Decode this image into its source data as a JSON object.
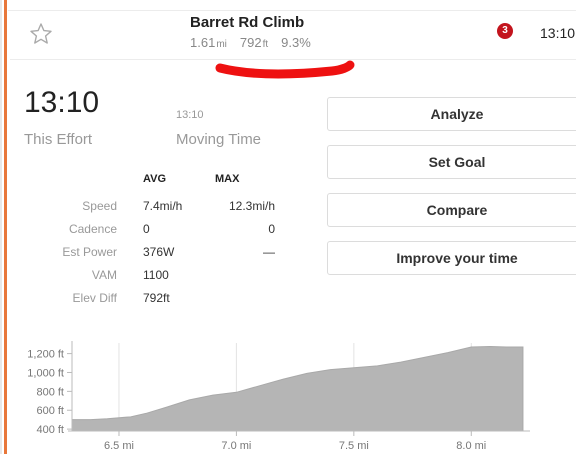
{
  "segment": {
    "title": "Barret Rd Climb",
    "distance_value": "1.61",
    "distance_unit": "mi",
    "elevation_value": "792",
    "elevation_unit": "ft",
    "grade": "9.3%",
    "notification_count": "3",
    "header_time": "13:10"
  },
  "effort": {
    "elapsed_time": "13:10",
    "elapsed_label": "This Effort",
    "moving_time": "13:10",
    "moving_label": "Moving Time"
  },
  "stats": {
    "avg_header": "AVG",
    "max_header": "MAX",
    "rows": [
      {
        "label": "Speed",
        "avg": "7.4mi/h",
        "max": "12.3mi/h"
      },
      {
        "label": "Cadence",
        "avg": "0",
        "max": "0"
      },
      {
        "label": "Est Power",
        "avg": "376W",
        "max": "—"
      },
      {
        "label": "VAM",
        "avg": "1100",
        "max": ""
      },
      {
        "label": "Elev Diff",
        "avg": "792ft",
        "max": ""
      }
    ]
  },
  "actions": {
    "analyze": "Analyze",
    "set_goal": "Set Goal",
    "compare": "Compare",
    "improve": "Improve your time"
  },
  "colors": {
    "accent": "#e8773a",
    "badge": "#c3141d",
    "redaction": "#ee1111",
    "profile_fill": "#b5b5b5"
  },
  "chart_data": {
    "type": "area",
    "xlabel": "",
    "ylabel": "",
    "x_ticks": [
      "6.5 mi",
      "7.0 mi",
      "7.5 mi",
      "8.0 mi"
    ],
    "x_tick_values": [
      6.5,
      7.0,
      7.5,
      8.0
    ],
    "y_ticks": [
      "1,200 ft",
      "1,000 ft",
      "800 ft",
      "600 ft",
      "400 ft"
    ],
    "y_tick_values": [
      1200,
      1000,
      800,
      600,
      400
    ],
    "xlim": [
      6.3,
      8.25
    ],
    "ylim": [
      380,
      1270
    ],
    "grid": "vertical",
    "x": [
      6.3,
      6.38,
      6.45,
      6.55,
      6.62,
      6.7,
      6.8,
      6.9,
      7.0,
      7.1,
      7.2,
      7.3,
      7.4,
      7.5,
      7.6,
      7.7,
      7.8,
      7.9,
      8.0,
      8.08,
      8.15,
      8.22
    ],
    "values": [
      500,
      500,
      510,
      530,
      570,
      630,
      710,
      760,
      790,
      860,
      930,
      990,
      1030,
      1050,
      1070,
      1110,
      1160,
      1210,
      1270,
      1275,
      1270,
      1270
    ]
  }
}
